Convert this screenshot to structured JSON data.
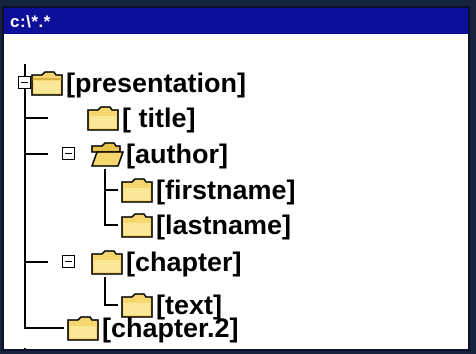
{
  "window": {
    "title": "c:\\*.*"
  },
  "tree": {
    "nodes": [
      {
        "label": "[presentation]",
        "icon": "folder-closed-icon",
        "expandable": true
      },
      {
        "label": "[ title]",
        "icon": "folder-closed-icon",
        "expandable": false
      },
      {
        "label": "[author]",
        "icon": "folder-open-icon",
        "expandable": true
      },
      {
        "label": "[firstname]",
        "icon": "folder-closed-icon",
        "expandable": false
      },
      {
        "label": "[lastname]",
        "icon": "folder-closed-icon",
        "expandable": false
      },
      {
        "label": "[chapter]",
        "icon": "folder-closed-icon",
        "expandable": true
      },
      {
        "label": "[text]",
        "icon": "folder-closed-icon",
        "expandable": false
      },
      {
        "label": "[chapter.2]",
        "icon": "folder-closed-icon",
        "expandable": false
      }
    ]
  },
  "colors": {
    "titlebar": "#0d0e9a",
    "background": "#15233d",
    "folder": "#f5d76e"
  }
}
